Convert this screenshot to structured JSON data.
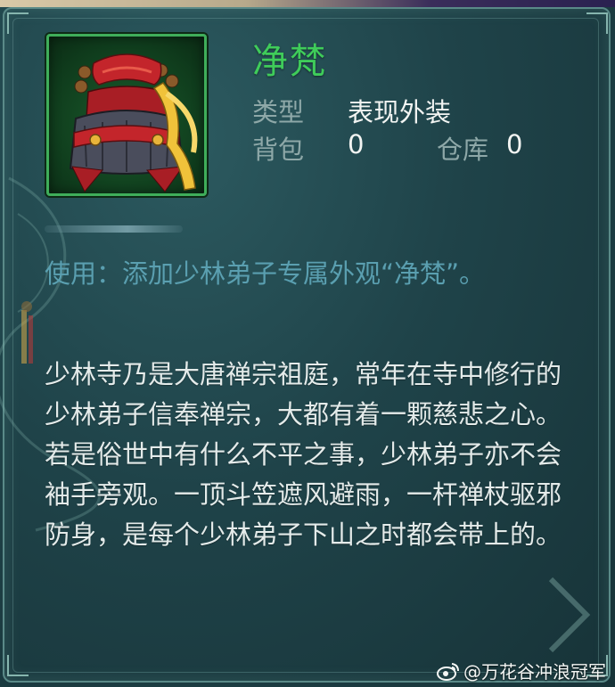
{
  "item": {
    "name": "净梵",
    "type_label": "类型",
    "type_value": "表现外装",
    "bag_label": "背包",
    "bag_count": "0",
    "warehouse_label": "仓库",
    "warehouse_count": "0",
    "icon": "shaolin-hat-icon"
  },
  "usage_text": "使用：添加少林弟子专属外观“净梵”。",
  "lore_text": "少林寺乃是大唐禅宗祖庭，常年在寺中修行的少林弟子信奉禅宗，大都有着一颗慈悲之心。若是俗世中有什么不平之事，少林弟子亦不会袖手旁观。一顶斗笠遮风避雨，一杆禅杖驱邪防身，是每个少林弟子下山之时都会带上的。",
  "watermark": {
    "icon": "weibo-icon",
    "text": "@万花谷冲浪冠军"
  },
  "colors": {
    "name": "#3fcc5a",
    "label": "#8ea8a8",
    "value": "#f2f4f2",
    "usage": "#5a9fb0",
    "lore": "#e4ebea",
    "icon_border": "#3fae5a",
    "panel_bg": "#1f4349"
  }
}
